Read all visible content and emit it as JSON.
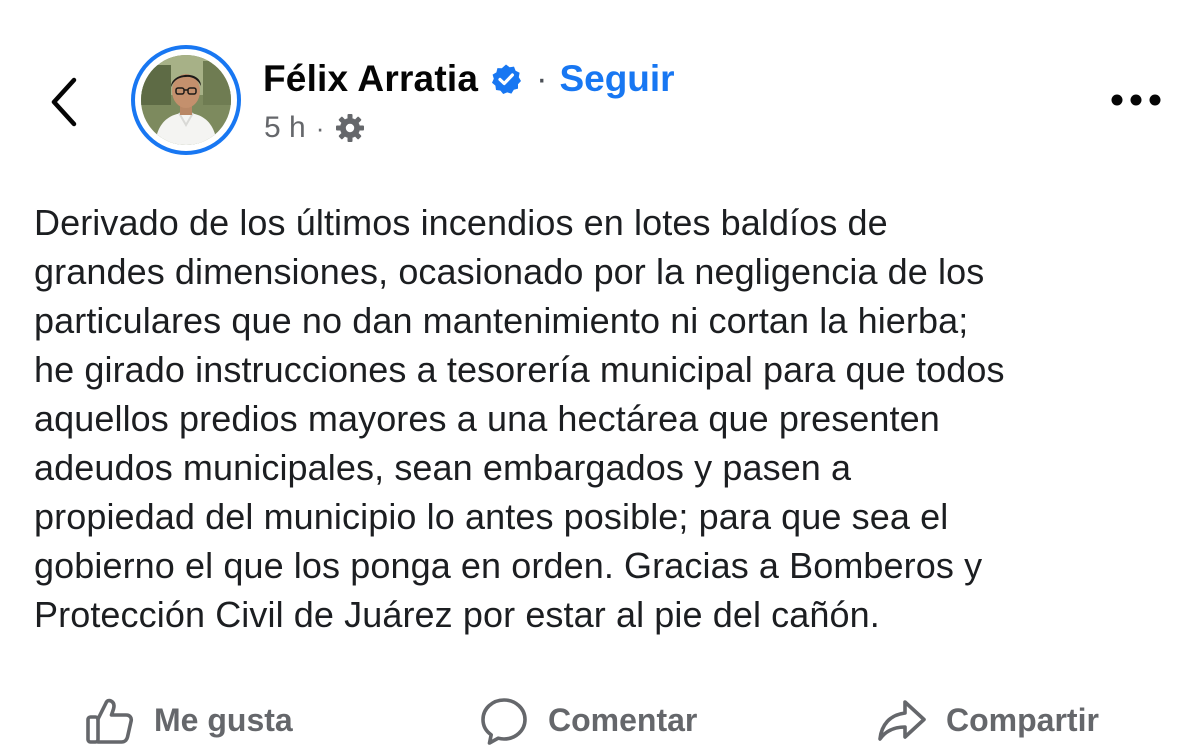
{
  "header": {
    "back_icon": "chevron-left-icon",
    "author_name": "Félix Arratia",
    "verified_icon": "verified-badge-icon",
    "separator": "·",
    "follow_label": "Seguir",
    "timestamp": "5 h",
    "meta_separator": "·",
    "privacy_icon": "gear-icon",
    "more_icon": "more-horizontal-icon"
  },
  "post": {
    "text": "Derivado de los últimos incendios en lotes baldíos de\ngrandes dimensiones, ocasionado por la negligencia de los\nparticulares que no dan mantenimiento ni cortan la hierba;\nhe girado instrucciones a tesorería municipal para que todos\naquellos predios mayores a una hectárea que presenten\nadeudos municipales, sean embargados y pasen a\npropiedad del municipio lo antes posible; para que sea el\ngobierno el que los ponga en orden. Gracias a Bomberos y\nProtección Civil de Juárez por estar al pie del cañón."
  },
  "actions": {
    "like_label": "Me gusta",
    "comment_label": "Comentar",
    "share_label": "Compartir"
  },
  "colors": {
    "accent": "#1877f2",
    "text_primary": "#050505",
    "text_secondary": "#65676b",
    "background": "#ffffff"
  }
}
